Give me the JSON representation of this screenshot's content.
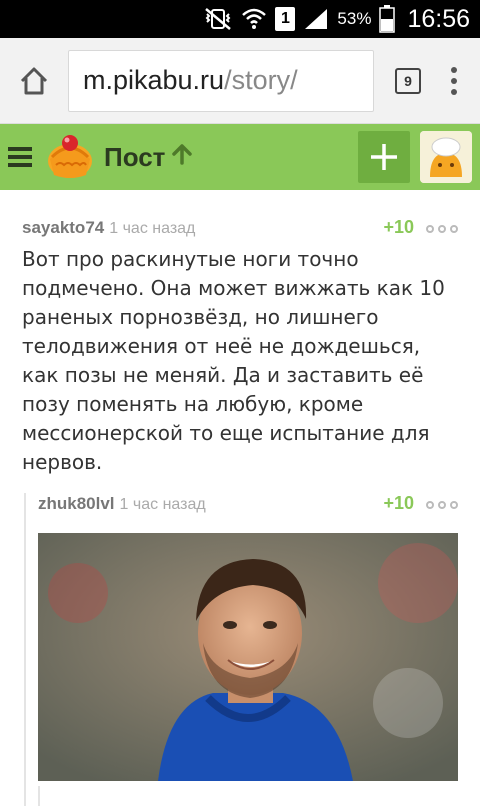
{
  "status_bar": {
    "battery_percent": "53%",
    "time": "16:56",
    "sim_label": "1",
    "icons": [
      "mute-vibrate-icon",
      "wifi-icon",
      "sim-icon",
      "signal-icon",
      "battery-icon"
    ]
  },
  "browser": {
    "url_host": "m.pikabu.ru",
    "url_path": "/story/",
    "tabs_count": "9"
  },
  "header": {
    "title": "Пост",
    "accent_color": "#8ac858"
  },
  "comments": [
    {
      "author": "sayakto74",
      "time": "1 час назад",
      "rating": "+10",
      "text": "Вот про раскинутые ноги точно подмечено. Она может вижжать как 10 раненых порнозвёзд, но лишнего телодвижения от неё не дождешься, как позы не меняй. Да и заставить её позу поменять на любую, кроме мессионерской то еще испытание для нервов."
    },
    {
      "author": "zhuk80lvl",
      "time": "1 час назад",
      "rating": "+10",
      "image": "photo of smiling man in blue hoodie"
    }
  ]
}
